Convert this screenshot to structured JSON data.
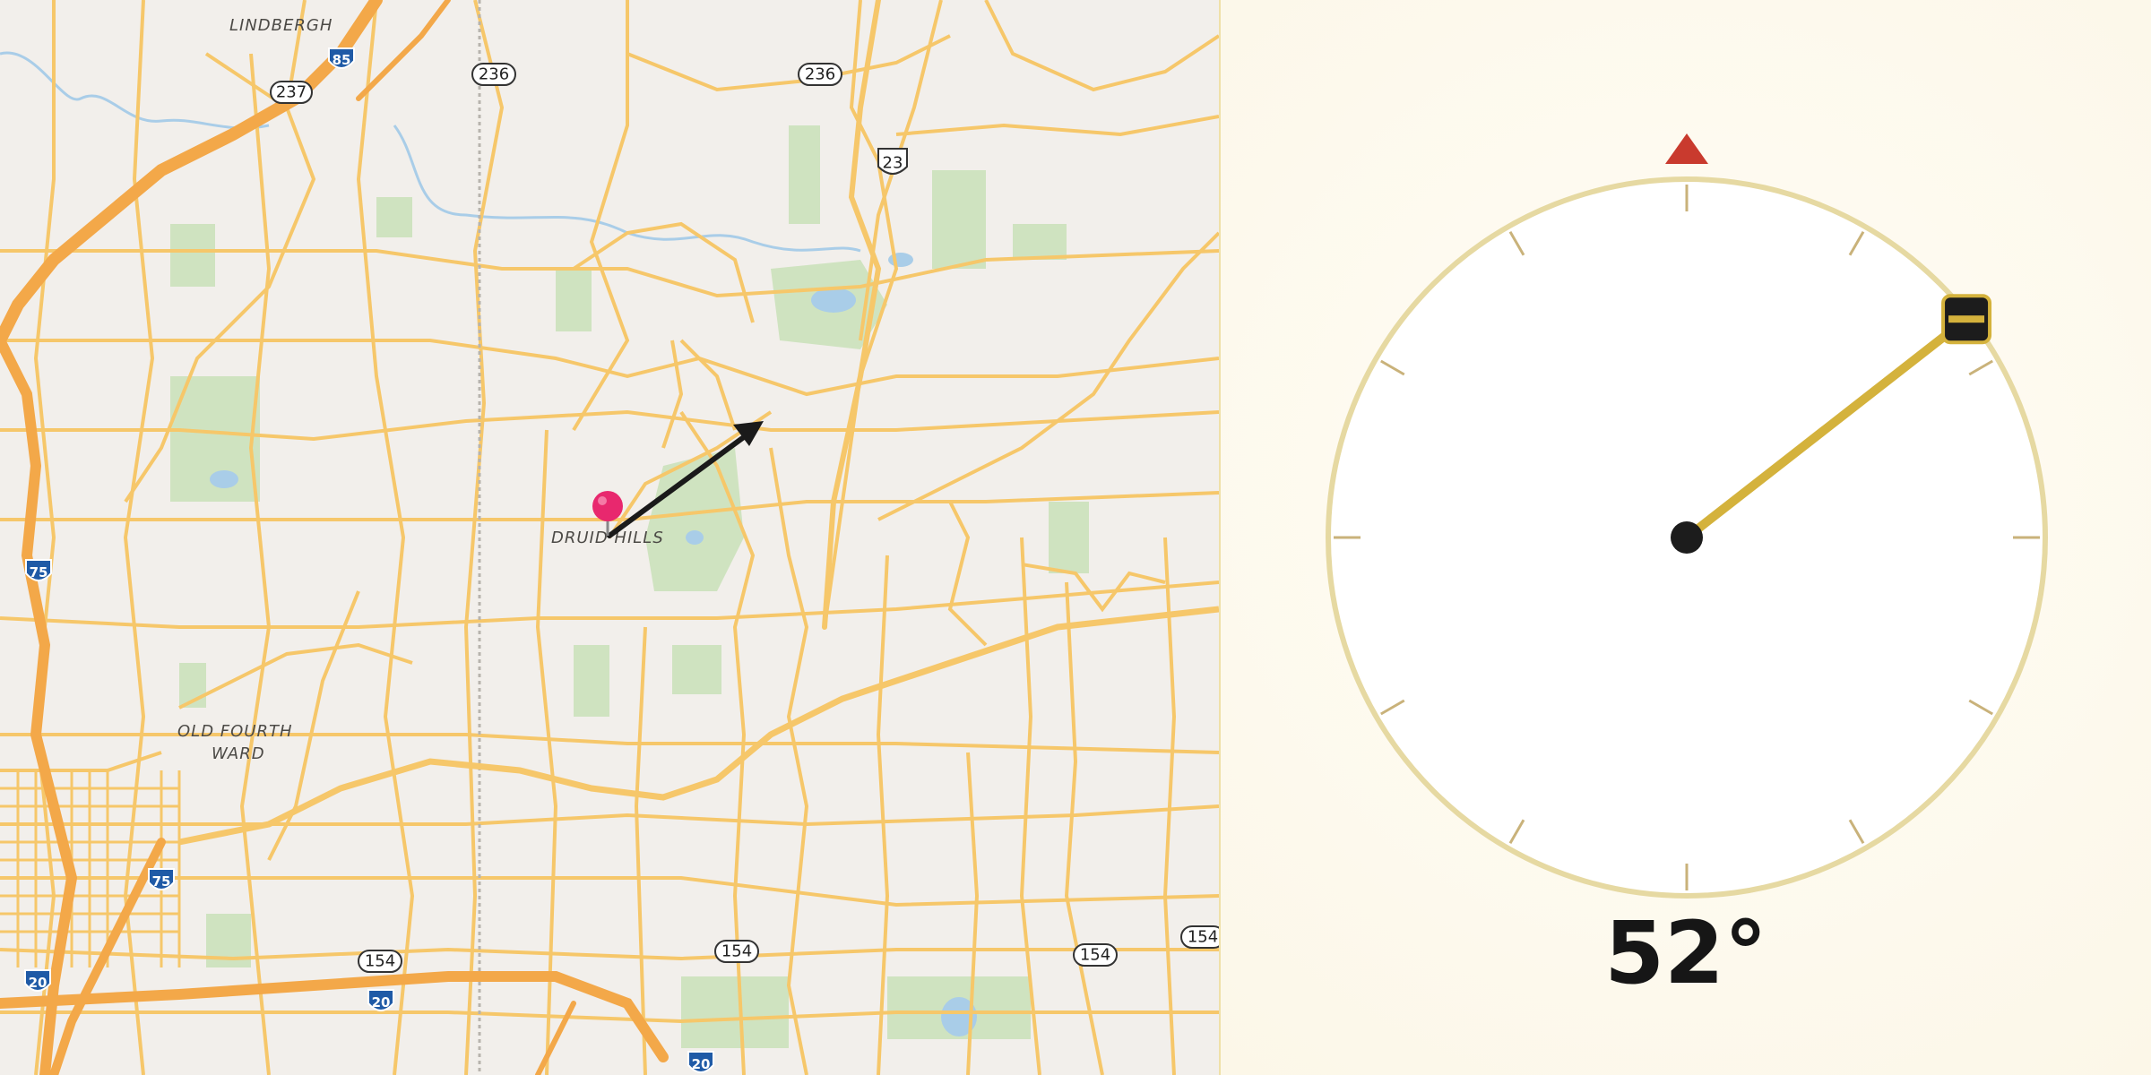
{
  "map": {
    "place_labels": [
      "LINDBERGH",
      "DRUID HILLS",
      "OLD FOURTH",
      "WARD"
    ],
    "route_shields": [
      {
        "text": "85",
        "kind": "interstate"
      },
      {
        "text": "237",
        "kind": "state"
      },
      {
        "text": "236",
        "kind": "state"
      },
      {
        "text": "236",
        "kind": "state"
      },
      {
        "text": "23",
        "kind": "us"
      },
      {
        "text": "75",
        "kind": "interstate"
      },
      {
        "text": "75",
        "kind": "interstate"
      },
      {
        "text": "154",
        "kind": "state"
      },
      {
        "text": "154",
        "kind": "state"
      },
      {
        "text": "154",
        "kind": "state"
      },
      {
        "text": "154",
        "kind": "state"
      },
      {
        "text": "20",
        "kind": "interstate"
      },
      {
        "text": "20",
        "kind": "interstate"
      },
      {
        "text": "20",
        "kind": "interstate"
      }
    ],
    "marker_icon": "map-pin-icon",
    "direction_icon": "direction-arrow-icon"
  },
  "compass": {
    "heading_value": 52,
    "heading_text": "52°",
    "north_marker_icon": "north-triangle-icon",
    "needle_handle_icon": "drag-handle-icon",
    "colors": {
      "ring": "#e6d9a2",
      "needle": "#d4b23c",
      "north": "#c93a2e",
      "ticks": "#c9b27a",
      "hub": "#1c1c1c"
    }
  },
  "colors": {
    "road": "#f6c76a",
    "highway": "#f3a849",
    "park": "#cfe3c0",
    "water": "#a9cde8",
    "pin": "#e8286e"
  }
}
